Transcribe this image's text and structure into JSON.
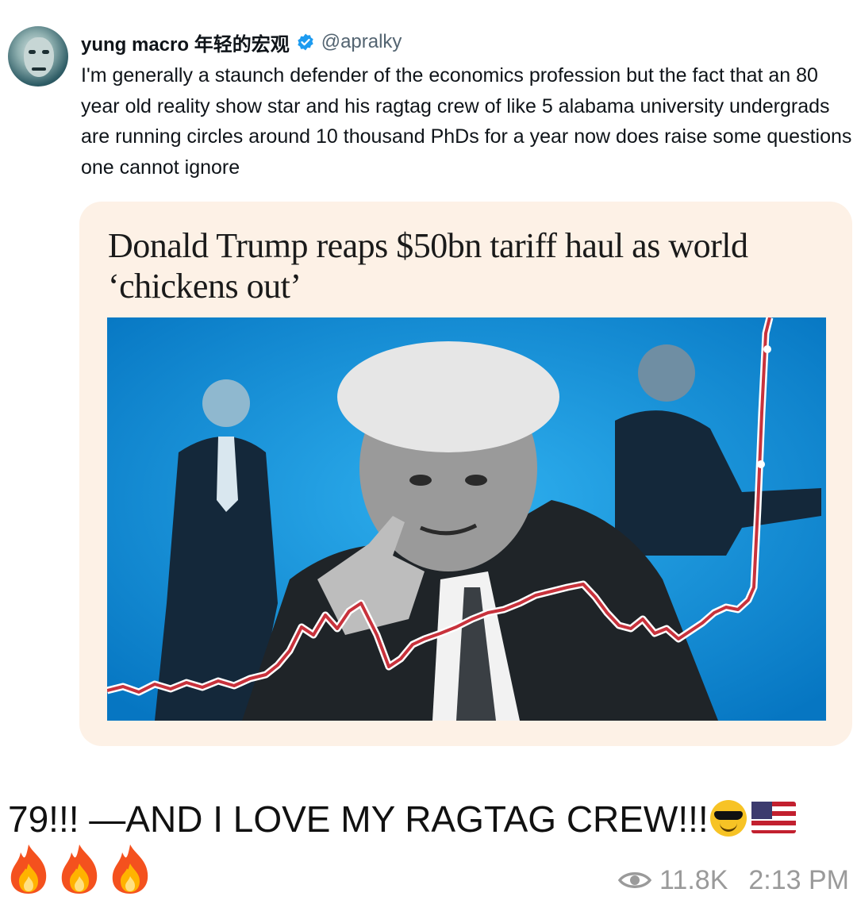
{
  "tweet": {
    "display_name": "yung macro 年轻的宏观",
    "handle": "@apralky",
    "text": "I'm generally a staunch defender of the economics profession but the fact that an 80 year old reality show star and his ragtag crew of like 5 alabama university undergrads are running circles around 10 thousand PhDs for a year now does raise some questions one cannot ignore",
    "verified_color": "#1d9bf0"
  },
  "article_card": {
    "headline": "Donald Trump reaps $50bn tariff haul as world ‘chickens out’",
    "image_background": "#0e93d8",
    "line_color": "#c8323c"
  },
  "post": {
    "caption": "79!!! —AND I LOVE MY RAGTAG CREW!!!",
    "caption_emojis": [
      "smiling-face-with-sunglasses",
      "flag-united-states"
    ],
    "reaction_emojis": [
      "fire",
      "fire",
      "fire"
    ],
    "views": "11.8K",
    "time": "2:13 PM"
  }
}
